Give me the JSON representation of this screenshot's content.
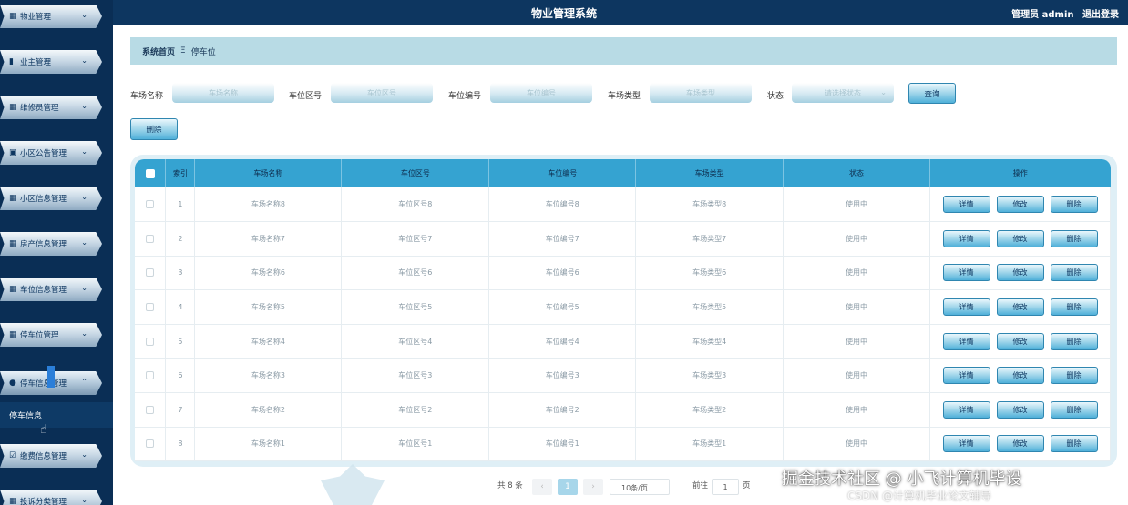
{
  "header": {
    "title": "物业管理系统",
    "user": "管理员 admin",
    "logout": "退出登录"
  },
  "sidebar": {
    "items": [
      {
        "label": "物业管理",
        "icon": "grid-icon"
      },
      {
        "label": "业主管理",
        "icon": "bar-chart-icon"
      },
      {
        "label": "维修员管理",
        "icon": "grid-icon"
      },
      {
        "label": "小区公告管理",
        "icon": "clipboard-icon"
      },
      {
        "label": "小区信息管理",
        "icon": "grid-icon"
      },
      {
        "label": "房产信息管理",
        "icon": "grid-icon"
      },
      {
        "label": "车位信息管理",
        "icon": "grid-icon"
      },
      {
        "label": "停车位管理",
        "icon": "grid-icon"
      },
      {
        "label": "停车信息管理",
        "icon": "user-icon"
      },
      {
        "label": "缴费信息管理",
        "icon": "check-square-icon"
      },
      {
        "label": "投诉分类管理",
        "icon": "grid-icon"
      }
    ],
    "sub_item": "停车信息"
  },
  "breadcrumb": {
    "home": "系统首页",
    "sep": "Ξ",
    "current": "停车位"
  },
  "search": {
    "fields": [
      {
        "label": "车场名称",
        "placeholder": "车场名称"
      },
      {
        "label": "车位区号",
        "placeholder": "车位区号"
      },
      {
        "label": "车位编号",
        "placeholder": "车位编号"
      },
      {
        "label": "车场类型",
        "placeholder": "车场类型"
      }
    ],
    "status_label": "状态",
    "status_placeholder": "请选择状态",
    "query_button": "查询",
    "delete_button": "删除"
  },
  "table": {
    "headers": [
      "索引",
      "车场名称",
      "车位区号",
      "车位编号",
      "车场类型",
      "状态",
      "操作"
    ],
    "actions": [
      "详情",
      "修改",
      "删除"
    ],
    "rows": [
      {
        "index": "1",
        "name": "车场名称8",
        "area": "车位区号8",
        "code": "车位编号8",
        "type": "车场类型8",
        "status": "使用中"
      },
      {
        "index": "2",
        "name": "车场名称7",
        "area": "车位区号7",
        "code": "车位编号7",
        "type": "车场类型7",
        "status": "使用中"
      },
      {
        "index": "3",
        "name": "车场名称6",
        "area": "车位区号6",
        "code": "车位编号6",
        "type": "车场类型6",
        "status": "使用中"
      },
      {
        "index": "4",
        "name": "车场名称5",
        "area": "车位区号5",
        "code": "车位编号5",
        "type": "车场类型5",
        "status": "使用中"
      },
      {
        "index": "5",
        "name": "车场名称4",
        "area": "车位区号4",
        "code": "车位编号4",
        "type": "车场类型4",
        "status": "使用中"
      },
      {
        "index": "6",
        "name": "车场名称3",
        "area": "车位区号3",
        "code": "车位编号3",
        "type": "车场类型3",
        "status": "使用中"
      },
      {
        "index": "7",
        "name": "车场名称2",
        "area": "车位区号2",
        "code": "车位编号2",
        "type": "车场类型2",
        "status": "使用中"
      },
      {
        "index": "8",
        "name": "车场名称1",
        "area": "车位区号1",
        "code": "车位编号1",
        "type": "车场类型1",
        "status": "使用中"
      }
    ]
  },
  "pagination": {
    "total": "共 8 条",
    "prev": "‹",
    "page": "1",
    "next": "›",
    "page_size": "10条/页",
    "goto": "前往",
    "goto_value": "1",
    "page_unit": "页"
  },
  "watermark": {
    "line1": "掘金技术社区 @ 小飞计算机毕设",
    "line2": "CSDN @计算机毕业论文辅导"
  }
}
